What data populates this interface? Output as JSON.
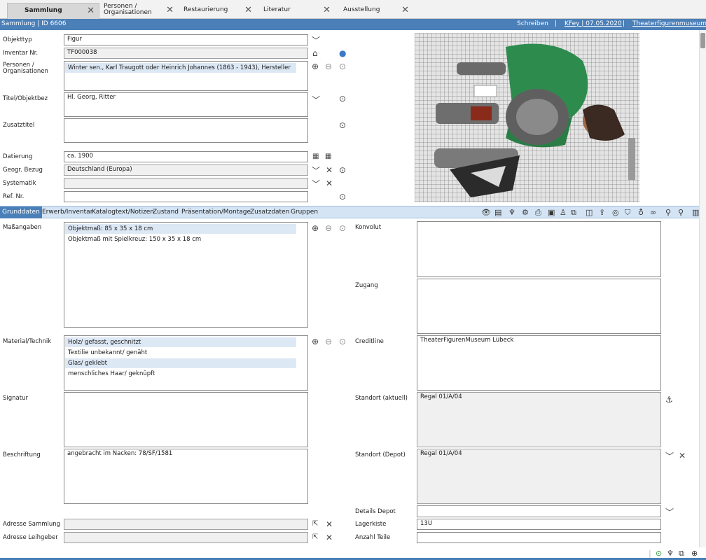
{
  "tabs": [
    {
      "label": "Sammlung",
      "active": true
    },
    {
      "label": "Personen / Organisationen",
      "active": false
    },
    {
      "label": "Restaurierung",
      "active": false
    },
    {
      "label": "Literatur",
      "active": false
    },
    {
      "label": "Ausstellung",
      "active": false
    }
  ],
  "header": {
    "title": "Sammlung | ID 6606",
    "action": "Schreiben",
    "user_date": "KFey | 07.05.2020",
    "institution": "Theaterfigurenmuseum",
    "separator": "|"
  },
  "form": {
    "objekttyp": {
      "label": "Objekttyp",
      "value": "Figur"
    },
    "inventar": {
      "label": "Inventar Nr.",
      "value": "TF000038"
    },
    "personen": {
      "label": "Personen / Organisationen",
      "items": [
        "Winter sen., Karl Traugott oder Heinrich Johannes (1863 - 1943), Hersteller"
      ]
    },
    "titel": {
      "label": "Titel/Objektbez",
      "value": "Hl. Georg, Ritter"
    },
    "zusatztitel": {
      "label": "Zusatztitel",
      "value": ""
    },
    "datierung": {
      "label": "Datierung",
      "value": "ca. 1900"
    },
    "geogr": {
      "label": "Geogr. Bezug",
      "value": "Deutschland (Europa)"
    },
    "systematik": {
      "label": "Systematik",
      "value": ""
    },
    "refnr": {
      "label": "Ref. Nr.",
      "value": ""
    }
  },
  "subtabs": [
    "Grunddaten",
    "Erwerb/Inventar",
    "Katalogtext/Notizen",
    "Zustand",
    "Präsentation/Montage",
    "Zusatzdaten",
    "Gruppen"
  ],
  "details": {
    "massangaben": {
      "label": "Maßangaben",
      "items": [
        "Objektmaß: 85 x 35 x 18 cm",
        "Objektmaß mit Spielkreuz: 150 x 35 x 18 cm"
      ]
    },
    "material": {
      "label": "Material/Technik",
      "items": [
        "Holz/ gefasst, geschnitzt",
        "Textilie unbekannt/ genäht",
        "Glas/ geklebt",
        "menschliches Haar/ geknüpft"
      ]
    },
    "signatur": {
      "label": "Signatur",
      "value": ""
    },
    "beschriftung": {
      "label": "Beschriftung",
      "value": "angebracht im Nacken: 78/SF/1581"
    },
    "adresse_sammlung": {
      "label": "Adresse Sammlung",
      "value": ""
    },
    "adresse_leihgeber": {
      "label": "Adresse Leihgeber",
      "value": ""
    },
    "konvolut": {
      "label": "Konvolut",
      "value": ""
    },
    "zugang": {
      "label": "Zugang",
      "value": ""
    },
    "creditline": {
      "label": "Creditline",
      "value": "TheaterFigurenMuseum Lübeck"
    },
    "standort_aktuell": {
      "label": "Standort (aktuell)",
      "value": "Regal 01/A/04"
    },
    "standort_depot": {
      "label": "Standort (Depot)",
      "value": "Regal 01/A/04"
    },
    "details_depot": {
      "label": "Details Depot",
      "value": ""
    },
    "lagerkiste": {
      "label": "Lagerkiste",
      "value": "13U"
    },
    "anzahl_teile": {
      "label": "Anzahl Teile",
      "value": ""
    }
  },
  "colors": {
    "accent": "#4a7fb8",
    "subtab_bg": "#d4e4f4",
    "selection": "#dde8f5"
  }
}
